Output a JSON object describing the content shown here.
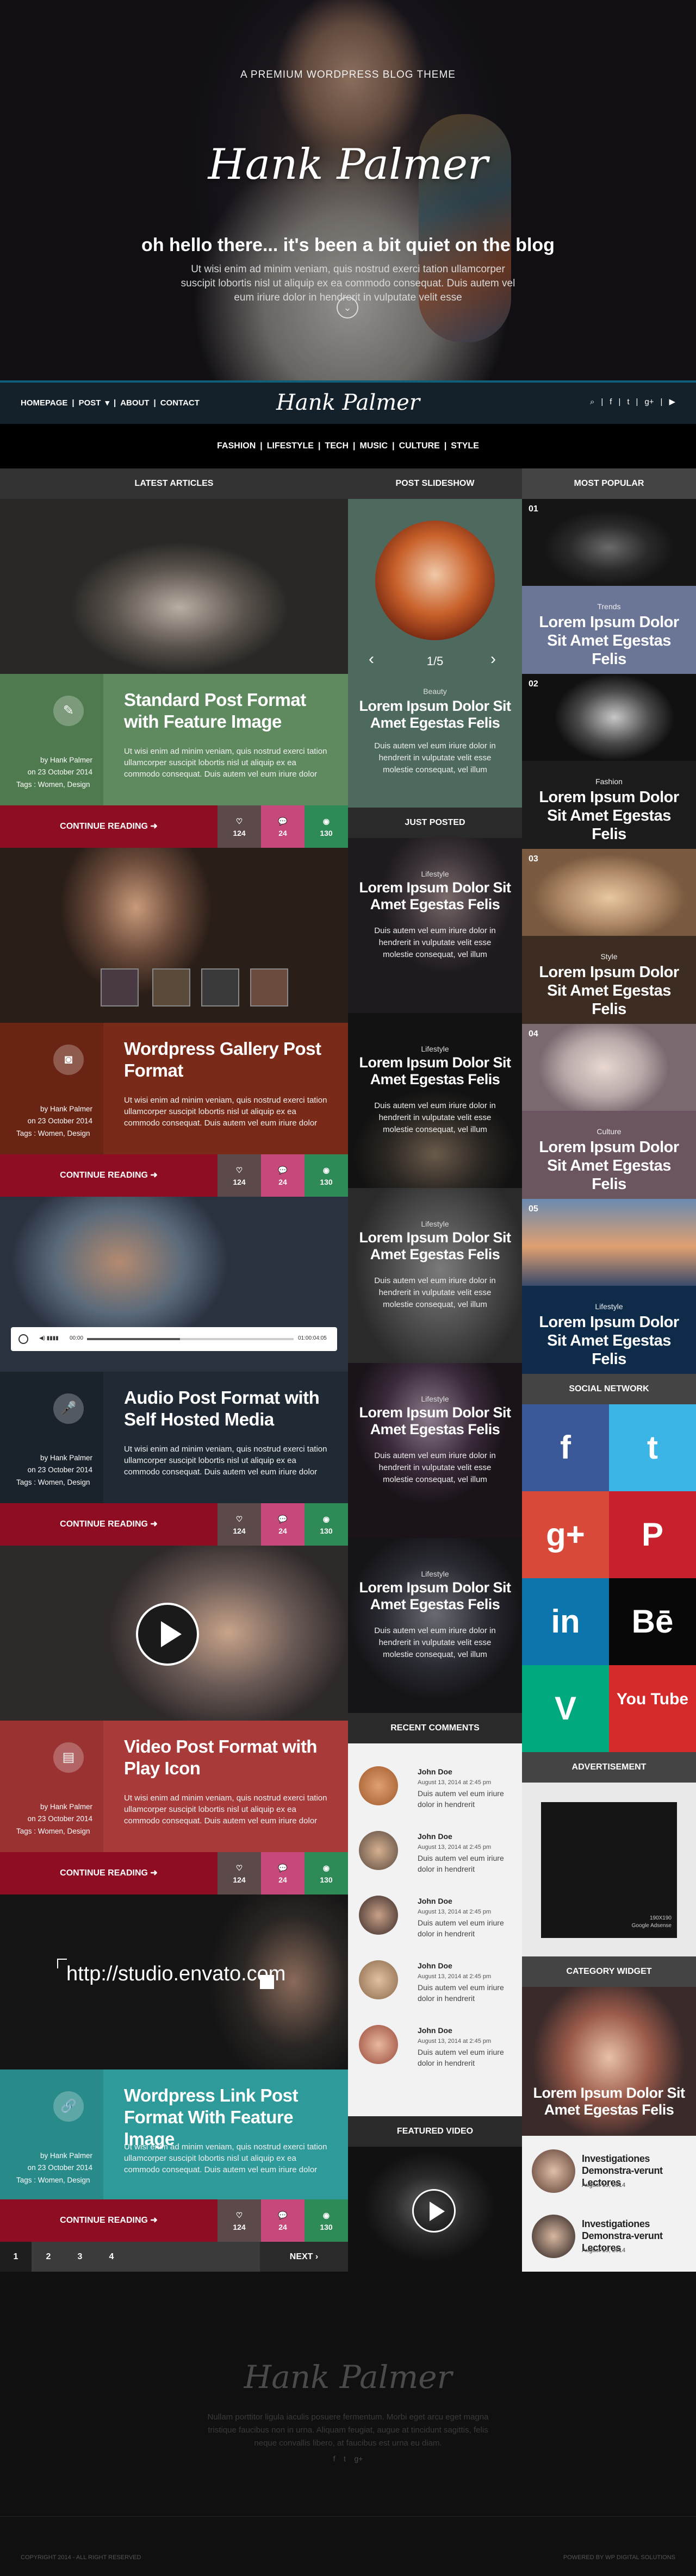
{
  "hero": {
    "tagline": "A PREMIUM WORDPRESS BLOG THEME",
    "logo": "Hank Palmer",
    "greeting": "oh hello there... it's been a bit quiet on the blog",
    "description": "Ut wisi enim ad minim veniam, quis nostrud exerci tation ullamcorper suscipit lobortis nisl ut aliquip ex ea commodo consequat. Duis autem vel eum iriure dolor in hendrerit in vulputate velit esse"
  },
  "nav": {
    "items": [
      "HOMEPAGE",
      "|",
      "POST",
      "▾",
      "|",
      "ABOUT",
      "|",
      "CONTACT"
    ],
    "logo": "Hank Palmer",
    "social": [
      "search-icon",
      "facebook-icon",
      "twitter-icon",
      "google-plus-icon",
      "youtube-icon"
    ]
  },
  "categories": [
    "FASHION",
    "|",
    "LIFESTYLE",
    "|",
    "TECH",
    "|",
    "MUSIC",
    "|",
    "CULTURE",
    "|",
    "STYLE"
  ],
  "columns": {
    "latest": "LATEST ARTICLES",
    "slideshow": "POST SLIDESHOW",
    "popular": "MOST POPULAR",
    "just_posted": "JUST POSTED",
    "social": "SOCIAL NETWORK",
    "comments": "RECENT COMMENTS",
    "ad": "ADVERTISEMENT",
    "featured_video": "FEATURED VIDEO",
    "category_widget": "CATEGORY WIDGET"
  },
  "posts": [
    {
      "title": "Standard Post Format with Feature Image",
      "icon": "pencil-icon",
      "color": "#5f8a5f",
      "author": "by Hank Palmer",
      "date": "on 23 October 2014",
      "tags": "Tags : Women, Design",
      "excerpt": "Ut wisi enim ad minim veniam, quis nostrud exerci tation ullamcorper suscipit lobortis nisl ut aliquip ex ea commodo consequat. Duis autem vel eum iriure dolor",
      "continue": "CONTINUE READING",
      "likes": "124",
      "comments": "24",
      "views": "130"
    },
    {
      "title": "Wordpress Gallery Post Format",
      "icon": "camera-icon",
      "color": "#7a2a18",
      "author": "by Hank Palmer",
      "date": "on 23 October 2014",
      "tags": "Tags : Women, Design",
      "excerpt": "Ut wisi enim ad minim veniam, quis nostrud exerci tation ullamcorper suscipit lobortis nisl ut aliquip ex ea commodo consequat. Duis autem vel eum iriure dolor",
      "continue": "CONTINUE READING",
      "likes": "124",
      "comments": "24",
      "views": "130"
    },
    {
      "title": "Audio Post Format with Self Hosted Media",
      "icon": "microphone-icon",
      "color": "#202a34",
      "author": "by Hank Palmer",
      "date": "on 23 October 2014",
      "tags": "Tags : Women, Design",
      "excerpt": "Ut wisi enim ad minim veniam, quis nostrud exerci tation ullamcorper suscipit lobortis nisl ut aliquip ex ea commodo consequat. Duis autem vel eum iriure dolor",
      "continue": "CONTINUE READING",
      "likes": "124",
      "comments": "24",
      "views": "130"
    },
    {
      "title": "Video Post Format with Play Icon",
      "icon": "film-icon",
      "color": "#a83a3a",
      "author": "by Hank Palmer",
      "date": "on 23 October 2014",
      "tags": "Tags : Women, Design",
      "excerpt": "Ut wisi enim ad minim veniam, quis nostrud exerci tation ullamcorper suscipit lobortis nisl ut aliquip ex ea commodo consequat. Duis autem vel eum iriure dolor",
      "continue": "CONTINUE READING",
      "likes": "124",
      "comments": "24",
      "views": "130"
    },
    {
      "title": "Wordpress Link Post Format With Feature Image",
      "icon": "link-icon",
      "color": "#2f9a9a",
      "author": "by Hank Palmer",
      "date": "on 23 October 2014",
      "tags": "Tags : Women, Design",
      "excerpt": "Ut wisi enim ad minim veniam, quis nostrud exerci tation ullamcorper suscipit lobortis nisl ut aliquip ex ea commodo consequat. Duis autem vel eum iriure dolor",
      "continue": "CONTINUE READING",
      "likes": "124",
      "comments": "24",
      "views": "130"
    }
  ],
  "audio": {
    "time": "00:00",
    "duration": "01:00:04:05"
  },
  "link_url": "http://studio.envato.com",
  "slideshow": {
    "counter": "1/5",
    "category": "Beauty",
    "title": "Lorem Ipsum Dolor Sit Amet Egestas Felis",
    "desc": "Duis autem vel eum iriure dolor in hendrerit in vulputate velit esse molestie consequat, vel illum"
  },
  "just_posted": [
    {
      "category": "Lifestyle",
      "title": "Lorem Ipsum Dolor Sit Amet Egestas Felis",
      "desc": "Duis autem vel eum iriure dolor in hendrerit in vulputate velit esse molestie consequat, vel illum"
    },
    {
      "category": "Lifestyle",
      "title": "Lorem Ipsum Dolor Sit Amet Egestas Felis",
      "desc": "Duis autem vel eum iriure dolor in hendrerit in vulputate velit esse molestie consequat, vel illum"
    },
    {
      "category": "Lifestyle",
      "title": "Lorem Ipsum Dolor Sit Amet Egestas Felis",
      "desc": "Duis autem vel eum iriure dolor in hendrerit in vulputate velit esse molestie consequat, vel illum"
    },
    {
      "category": "Lifestyle",
      "title": "Lorem Ipsum Dolor Sit Amet Egestas Felis",
      "desc": "Duis autem vel eum iriure dolor in hendrerit in vulputate velit esse molestie consequat, vel illum"
    },
    {
      "category": "Lifestyle",
      "title": "Lorem Ipsum Dolor Sit Amet Egestas Felis",
      "desc": "Duis autem vel eum iriure dolor in hendrerit in vulputate velit esse molestie consequat, vel illum"
    }
  ],
  "popular": [
    {
      "num": "01",
      "category": "Trends",
      "title": "Lorem Ipsum Dolor Sit Amet Egestas Felis",
      "color": "#6b7596"
    },
    {
      "num": "02",
      "category": "Fashion",
      "title": "Lorem Ipsum Dolor Sit Amet Egestas Felis",
      "color": "#1b1b1b"
    },
    {
      "num": "03",
      "category": "Style",
      "title": "Lorem Ipsum Dolor Sit Amet Egestas Felis",
      "color": "#3d2c22"
    },
    {
      "num": "04",
      "category": "Culture",
      "title": "Lorem Ipsum Dolor Sit Amet Egestas Felis",
      "color": "#6a5560"
    },
    {
      "num": "05",
      "category": "Lifestyle",
      "title": "Lorem Ipsum Dolor Sit Amet Egestas Felis",
      "color": "#0e2c4a"
    }
  ],
  "social_network": [
    "facebook-icon",
    "twitter-icon",
    "google-plus-icon",
    "pinterest-icon",
    "linkedin-icon",
    "behance-icon",
    "vine-icon",
    "youtube-icon"
  ],
  "social_glyphs": [
    "f",
    "t",
    "g+",
    "P",
    "in",
    "Bē",
    "V",
    "You Tube"
  ],
  "comments": [
    {
      "name": "John Doe",
      "date": "August 13, 2014 at 2:45 pm",
      "text": "Duis autem vel eum iriure dolor in hendrerit"
    },
    {
      "name": "John Doe",
      "date": "August 13, 2014 at 2:45 pm",
      "text": "Duis autem vel eum iriure dolor in hendrerit"
    },
    {
      "name": "John Doe",
      "date": "August 13, 2014 at 2:45 pm",
      "text": "Duis autem vel eum iriure dolor in hendrerit"
    },
    {
      "name": "John Doe",
      "date": "August 13, 2014 at 2:45 pm",
      "text": "Duis autem vel eum iriure dolor in hendrerit"
    },
    {
      "name": "John Doe",
      "date": "August 13, 2014 at 2:45 pm",
      "text": "Duis autem vel eum iriure dolor in hendrerit"
    }
  ],
  "ad": {
    "size": "190X190",
    "source": "Google Adsense"
  },
  "category_widget": {
    "featured": "Lorem Ipsum Dolor Sit Amet Egestas Felis",
    "items": [
      {
        "title": "Investigationes Demonstra-verunt Lectores",
        "date": "August 13, 2014"
      },
      {
        "title": "Investigationes Demonstra-verunt Lectores",
        "date": "August 13, 2014"
      }
    ]
  },
  "pager": {
    "pages": [
      "1",
      "2",
      "3",
      "4"
    ],
    "next": "NEXT ›"
  },
  "footer": {
    "logo": "Hank Palmer",
    "text": "Nullam porttitor ligula iaculis posuere fermentum. Morbi eget arcu eget magna tristique faucibus non in urna. Aliquam feugiat, augue at tincidunt sagittis, felis neque convallis libero, at faucibus est urna eu diam.",
    "social": [
      "facebook-icon",
      "twitter-icon",
      "google-plus-icon"
    ],
    "copyright": "COPYRIGHT 2014 - ALL RIGHT RESERVED",
    "powered": "POWERED BY WP DIGITAL SOLUTIONS"
  },
  "colors": {
    "accent_red": "#8e0d22",
    "teal": "#0f5f7a",
    "likes_bg": "#5c4a4a",
    "comments_bg": "#c7487a",
    "views_bg": "#2e8b57"
  }
}
